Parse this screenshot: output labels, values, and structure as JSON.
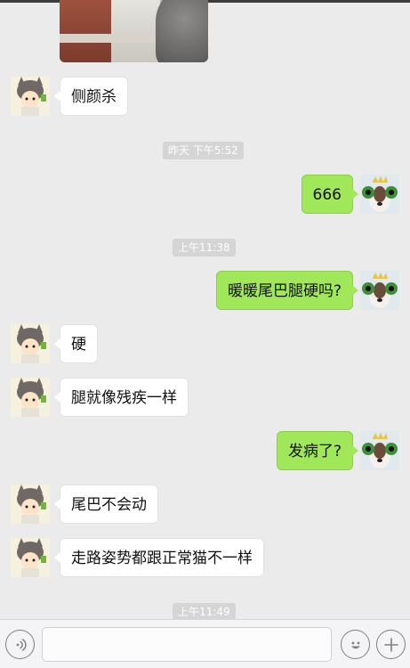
{
  "icons": {
    "voice": "voice-icon",
    "emoji": "emoji-icon",
    "plus": "plus-icon"
  },
  "colors": {
    "background": "#ebebeb",
    "incoming_bubble": "#ffffff",
    "outgoing_bubble": "#a0e75a",
    "timestamp_bg": "#d5d5d5",
    "input_bar": "#f4f4f6"
  },
  "messages": [
    {
      "kind": "in",
      "text": "侧颜杀"
    },
    {
      "kind": "time",
      "text": "昨天 下午5:52"
    },
    {
      "kind": "out",
      "text": "666"
    },
    {
      "kind": "time",
      "text": "上午11:38"
    },
    {
      "kind": "out",
      "text": "暖暖尾巴腿硬吗?"
    },
    {
      "kind": "in",
      "text": "硬"
    },
    {
      "kind": "in",
      "text": "腿就像残疾一样"
    },
    {
      "kind": "out",
      "text": "发病了?"
    },
    {
      "kind": "in",
      "text": "尾巴不会动"
    },
    {
      "kind": "in",
      "text": "走路姿势都跟正常猫不一样"
    },
    {
      "kind": "time",
      "text": "上午11:49"
    }
  ],
  "input": {
    "value": ""
  }
}
